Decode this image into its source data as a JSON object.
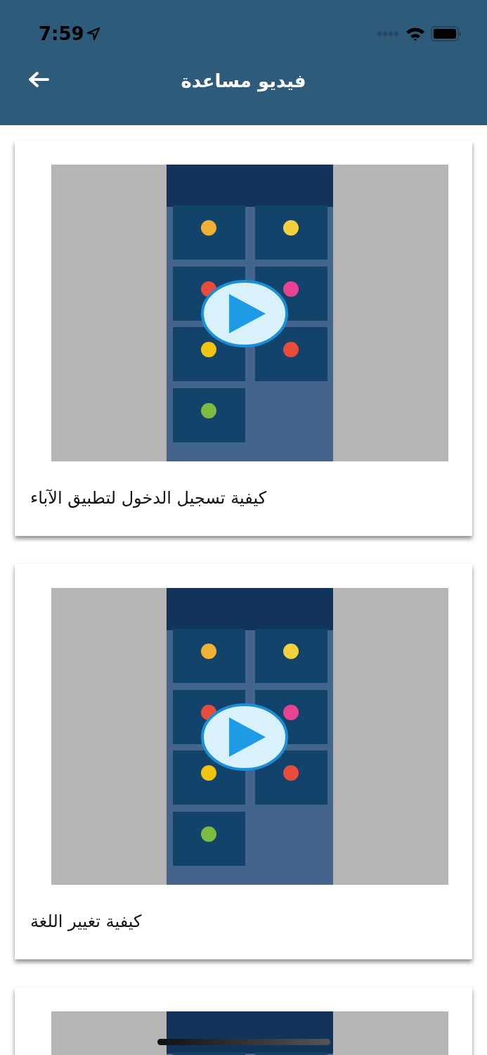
{
  "status_bar": {
    "time": "7:59"
  },
  "header": {
    "title": "فيديو مساعدة"
  },
  "videos": [
    {
      "kind": "picture",
      "play_button": true,
      "title": "كيفية تسجيل الدخول لتطبيق الآباء"
    },
    {
      "kind": "picture",
      "play_button": true,
      "title": "كيفية تغيير اللغة"
    },
    {
      "kind": "picture"
    }
  ]
}
